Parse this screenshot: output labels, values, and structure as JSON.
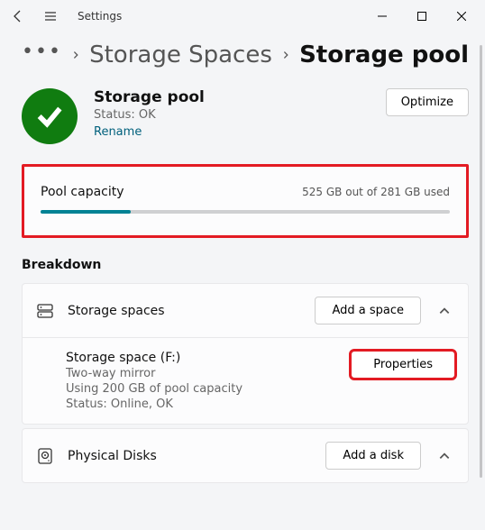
{
  "app": {
    "title": "Settings"
  },
  "breadcrumb": {
    "parent": "Storage Spaces",
    "current": "Storage pool"
  },
  "pool": {
    "name": "Storage pool",
    "status": "Status: OK",
    "rename": "Rename",
    "optimize": "Optimize"
  },
  "capacity": {
    "label": "Pool capacity",
    "text": "525  GB out of 281 GB used",
    "percent": 22
  },
  "breakdown": {
    "title": "Breakdown",
    "spaces": {
      "title": "Storage spaces",
      "add": "Add a space",
      "item": {
        "name": "Storage space (F:)",
        "type": "Two-way mirror",
        "usage": "Using 200  GB of pool capacity",
        "status": "Status: Online, OK",
        "properties": "Properties"
      }
    },
    "disks": {
      "title": "Physical Disks",
      "add": "Add a disk"
    }
  }
}
